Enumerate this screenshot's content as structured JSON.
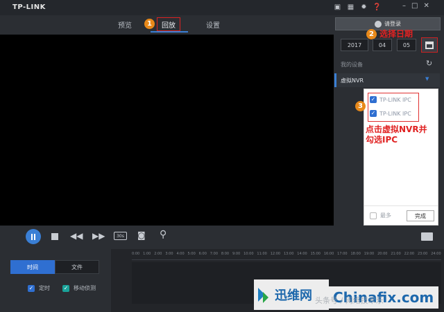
{
  "app": {
    "logo": "TP-LINK"
  },
  "titlebar": {
    "icons": [
      "lock-icon",
      "chip-icon",
      "gear-icon",
      "help-icon"
    ],
    "window_buttons": [
      "–",
      "□",
      "✕"
    ]
  },
  "nav": {
    "tabs": [
      {
        "label": "预览"
      },
      {
        "label": "回放",
        "active": true
      },
      {
        "label": "设置"
      }
    ]
  },
  "login": {
    "label": "请登录"
  },
  "date": {
    "year": "2017",
    "month": "04",
    "day": "05"
  },
  "devices": {
    "header": "我的设备",
    "nvr": "虚拟NVR",
    "ipcs": [
      {
        "label": "TP-LINK IPC",
        "checked": true
      },
      {
        "label": "TP-LINK IPC",
        "checked": true
      }
    ],
    "more_label": "最多",
    "done_label": "完成"
  },
  "annotations": {
    "a1": {
      "num": "1"
    },
    "a2": {
      "num": "2",
      "text": "选择日期"
    },
    "a3": {
      "num": "3",
      "line1": "点击虚拟NVR并",
      "line2": "勾选IPC"
    }
  },
  "controls": {
    "speed_badge": "30s"
  },
  "bottom": {
    "seg_time": "时间",
    "seg_file": "文件",
    "filter_timed": "定时",
    "filter_motion": "移动侦测"
  },
  "timeline": {
    "ticks": [
      "0:00",
      "1:00",
      "2:00",
      "3:00",
      "4:00",
      "5:00",
      "6:00",
      "7:00",
      "8:00",
      "9:00",
      "10:00",
      "11:00",
      "12:00",
      "13:00",
      "14:00",
      "15:00",
      "16:00",
      "17:00",
      "18:00",
      "19:00",
      "20:00",
      "21:00",
      "22:00",
      "23:00",
      "24:00"
    ]
  },
  "watermark": {
    "cn": "迅维网",
    "en": "Chinafix.com",
    "faint": "头条号 / 网络技术乐"
  },
  "colors": {
    "accent": "#3a7fd5",
    "annotation_red": "#e02222",
    "annotation_orange": "#e8891a"
  }
}
